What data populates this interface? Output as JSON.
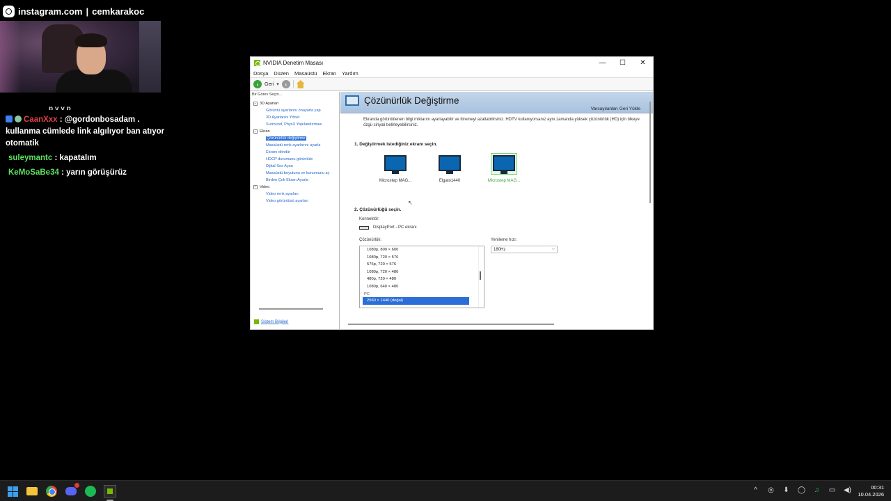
{
  "overlay": {
    "instagram_handle": "instagram.com",
    "separator": "|",
    "username": "cemkarakoc"
  },
  "chat": {
    "cutoff_text": "p y y p",
    "messages": [
      {
        "user": "CaanXxx",
        "user_color": "#e0414a",
        "text": ": @gordonbosadam . kullanma cümlede link algılıyor ban atıyor otomatik",
        "mention": "@gordonbosadam"
      },
      {
        "user": "suleymantc",
        "user_color": "#5de05d",
        "text": ": kapatalım"
      },
      {
        "user": "KeMoSaBe34",
        "user_color": "#5de05d",
        "text": ": yarın görüşürüz"
      }
    ]
  },
  "window": {
    "title": "NVIDIA Denetim Masası",
    "controls": {
      "minimize": "—",
      "maximize": "☐",
      "close": "✕"
    },
    "menu": [
      "Dosya",
      "Düzen",
      "Masaüstü",
      "Ekran",
      "Yardım"
    ],
    "toolbar": {
      "back_label": "Geri",
      "dropdown_caret": "▾"
    },
    "left_pane": {
      "task_label": "Bir Görev Seçin...",
      "groups": [
        {
          "label": "3D Ayarları",
          "expander": "−",
          "items": [
            "Görüntü ayarlarını önayarla yap",
            "3D Ayarlarını Yönet",
            "Surround, PhysX Yapılandırması"
          ]
        },
        {
          "label": "Ekran",
          "expander": "−",
          "items": [
            "Çözünürlük değiştirme",
            "Masaüstü renk ayarlarını ayarla",
            "Ekranı döndür",
            "HDCP durumunu görüntüle",
            "Dijital Ses Ayarı",
            "Masaüstü boyutunu ve konumunu ay",
            "Birden Çok Ekran Ayarla"
          ],
          "selected": 0
        },
        {
          "label": "Video",
          "expander": "−",
          "items": [
            "Video renk ayarları",
            "Video görüntüsü ayarları"
          ]
        }
      ],
      "system_info": "Sistem Bilgileri"
    },
    "main": {
      "title": "Çözünürlük Değiştirme",
      "restore_defaults": "Varsayılanları Geri Yükle",
      "description": "Ekranda görüntülenen bilgi miktarını ayarlayabilir ve titremeyi azaltabilirsiniz. HDTV kullanıyorsanız aynı zamanda yüksek çözünürlük (HD) için ülkeye özgü sinyali belirleyebilirsiniz.",
      "step1": "1. Değiştirmek istediğiniz ekranı seçin.",
      "monitors": [
        {
          "label": "Microstep MAG...",
          "active": false
        },
        {
          "label": "Elgato1440",
          "active": false
        },
        {
          "label": "Microstep MAG...",
          "active": true
        }
      ],
      "step2": "2. Çözünürlüğü seçin.",
      "connector_label": "Konnektör:",
      "connector_value": "DisplayPort - PC ekranı",
      "resolution_label": "Çözünürlük:",
      "resolutions": [
        "1080p, 800 × 600",
        "1080p, 720 × 576",
        "576p, 720 × 576",
        "1080p, 720 × 480",
        "480p, 720 × 480",
        "1080p, 640 × 480"
      ],
      "resolution_group": "PC",
      "selected_resolution": "2560 × 1440 (doğal)",
      "refresh_label": "Yenileme hızı:",
      "refresh_value": "180Hz"
    }
  },
  "taskbar": {
    "apps": [
      "start-icon",
      "file-explorer-icon",
      "chrome-icon",
      "discord-icon",
      "spotify-icon",
      "nvidia-control-panel-icon"
    ],
    "tray": [
      "^",
      "◎",
      "⬇",
      "◯",
      "♫",
      "▭",
      "◀)"
    ],
    "time": "00:31",
    "date": "10.04.2026"
  },
  "colors": {
    "nvidia_green": "#76b900",
    "selection_blue": "#2b6ed6",
    "header_blue": "#a9c2df",
    "link_blue": "#2468c9"
  }
}
